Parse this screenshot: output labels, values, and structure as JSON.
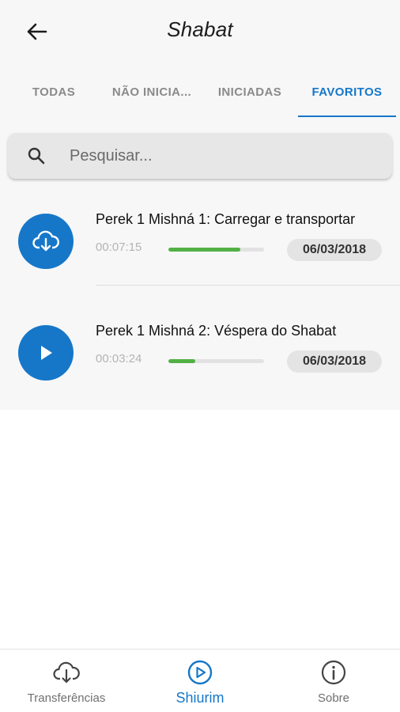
{
  "header": {
    "title": "Shabat",
    "back_icon": "arrow-back-icon"
  },
  "tabs": [
    {
      "label": "TODAS",
      "active": false
    },
    {
      "label": "NÃO INICIA...",
      "active": false
    },
    {
      "label": "INICIADAS",
      "active": false
    },
    {
      "label": "FAVORITOS",
      "active": true
    }
  ],
  "search": {
    "placeholder": "Pesquisar...",
    "value": "",
    "icon": "search-icon"
  },
  "items": [
    {
      "title": "Perek 1 Mishná 1: Carregar e transportar",
      "duration": "00:07:15",
      "progress": 0.75,
      "date": "06/03/2018",
      "action_icon": "cloud-download-icon"
    },
    {
      "title": "Perek 1 Mishná 2: Véspera do Shabat",
      "duration": "00:03:24",
      "progress": 0.28,
      "date": "06/03/2018",
      "action_icon": "play-icon"
    }
  ],
  "bottom_nav": [
    {
      "label": "Transferências",
      "icon": "cloud-download-icon",
      "active": false
    },
    {
      "label": "Shiurim",
      "icon": "play-circle-icon",
      "active": true
    },
    {
      "label": "Sobre",
      "icon": "info-icon",
      "active": false
    }
  ],
  "colors": {
    "accent": "#1677c9",
    "progress": "#52b045",
    "background": "#f7f7f7"
  }
}
